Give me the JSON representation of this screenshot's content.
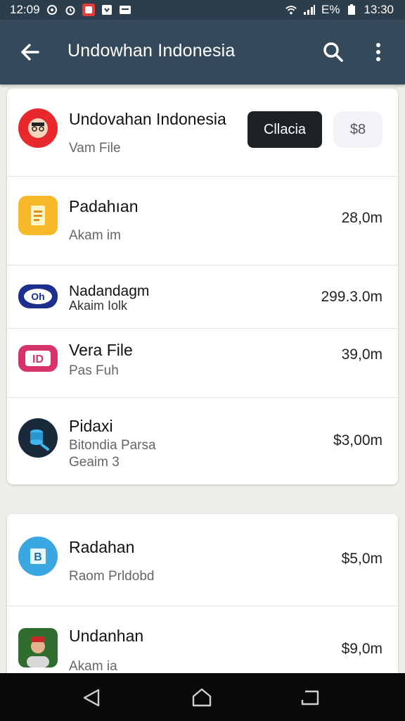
{
  "status": {
    "time_left": "12:09",
    "time_right": "13:30",
    "net_label": "E%"
  },
  "appbar": {
    "title": "Undowhan Indonesia"
  },
  "card1": {
    "header": {
      "name": "Undovahan Indonesia",
      "sub": "Vam File",
      "primary_button": "Cllacia",
      "secondary_button": "$8"
    },
    "items": [
      {
        "name": "Padahıan",
        "sub": "Akam im",
        "amount": "28,0m"
      },
      {
        "name": "Nadandagm",
        "sub": "Akaim Iolk",
        "amount": "299.3.0m"
      },
      {
        "name": "Vera File",
        "sub": "Pas Fuh",
        "amount": "39,0m"
      },
      {
        "name": "Pidaxi",
        "sub": "Bitondia Parsa",
        "sub2": "Geaim 3",
        "amount": "$3,00m"
      }
    ]
  },
  "card2": {
    "items": [
      {
        "name": "Radahan",
        "sub": "Raom Prldobd",
        "amount": "$5,0m"
      },
      {
        "name": "Undanhan",
        "sub": "Akam ia",
        "amount": "$9,0m"
      }
    ]
  },
  "icons": {
    "back": "arrow-left-icon",
    "search": "search-icon",
    "more": "more-vertical-icon",
    "nav_back": "triangle-back-icon",
    "nav_home": "home-icon",
    "nav_recent": "recent-apps-icon"
  },
  "colors": {
    "appbar": "#34495a",
    "statusbar": "#2c3d4c",
    "primary_button": "#1c2226"
  }
}
